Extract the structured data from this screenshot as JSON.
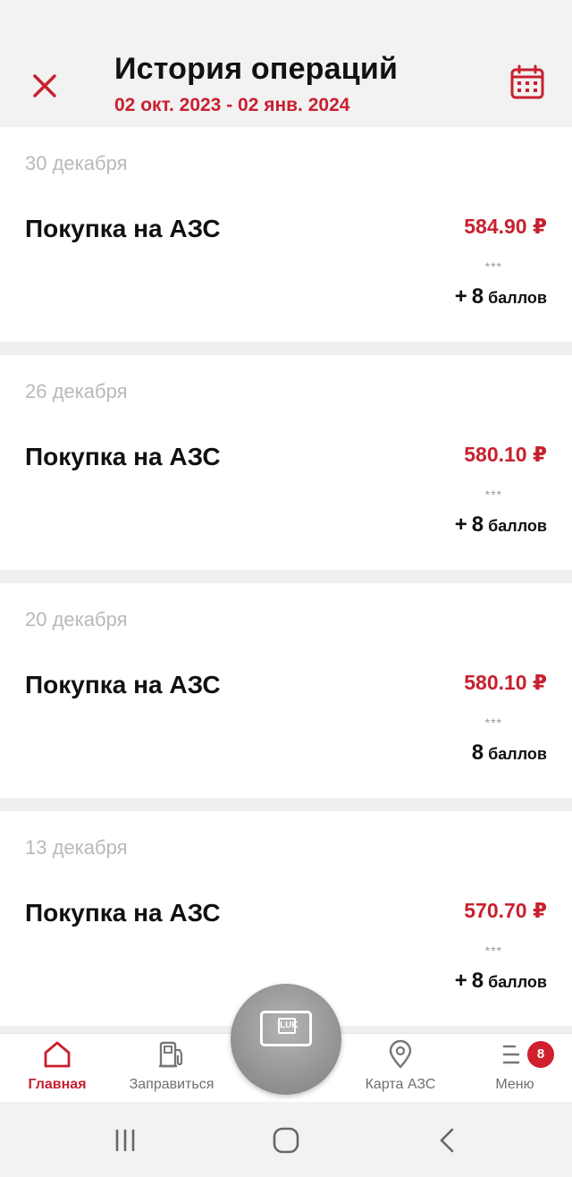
{
  "header": {
    "title": "История операций",
    "date_range": "02 окт. 2023 - 02 янв. 2024",
    "close_icon": "close-icon",
    "calendar_icon": "calendar-icon"
  },
  "colors": {
    "accent": "#c8202f",
    "date_text": "#b9b9b9",
    "card_background": "#ffffff",
    "page_background": "#efefef"
  },
  "transactions": [
    {
      "date": "30 декабря",
      "title": "Покупка на АЗС",
      "amount": "584.90 ₽",
      "card_mask": "***",
      "points_sign": "+",
      "points_value": "8",
      "points_unit": "баллов"
    },
    {
      "date": "26 декабря",
      "title": "Покупка на АЗС",
      "amount": "580.10 ₽",
      "card_mask": "***",
      "points_sign": "+",
      "points_value": "8",
      "points_unit": "баллов"
    },
    {
      "date": "20 декабря",
      "title": "Покупка на АЗС",
      "amount": "580.10 ₽",
      "card_mask": "***",
      "points_sign": "",
      "points_value": "8",
      "points_unit": "баллов"
    },
    {
      "date": "13 декабря",
      "title": "Покупка на АЗС",
      "amount": "570.70 ₽",
      "card_mask": "***",
      "points_sign": "+",
      "points_value": "8",
      "points_unit": "баллов"
    }
  ],
  "bottom_nav": {
    "items": [
      {
        "label": "Главная",
        "icon": "home-icon",
        "active": true
      },
      {
        "label": "Заправиться",
        "icon": "fuel-pump-icon",
        "active": false
      },
      {
        "label": "Карта АЗС",
        "icon": "map-pin-icon",
        "active": false
      },
      {
        "label": "Меню",
        "icon": "menu-icon",
        "active": false,
        "badge": "8"
      }
    ],
    "center_button": {
      "icon": "loyalty-card-icon",
      "logo_text": "LUK"
    }
  },
  "system_nav": {
    "icons": [
      "recent-apps-icon",
      "home-circle-icon",
      "back-icon"
    ]
  }
}
